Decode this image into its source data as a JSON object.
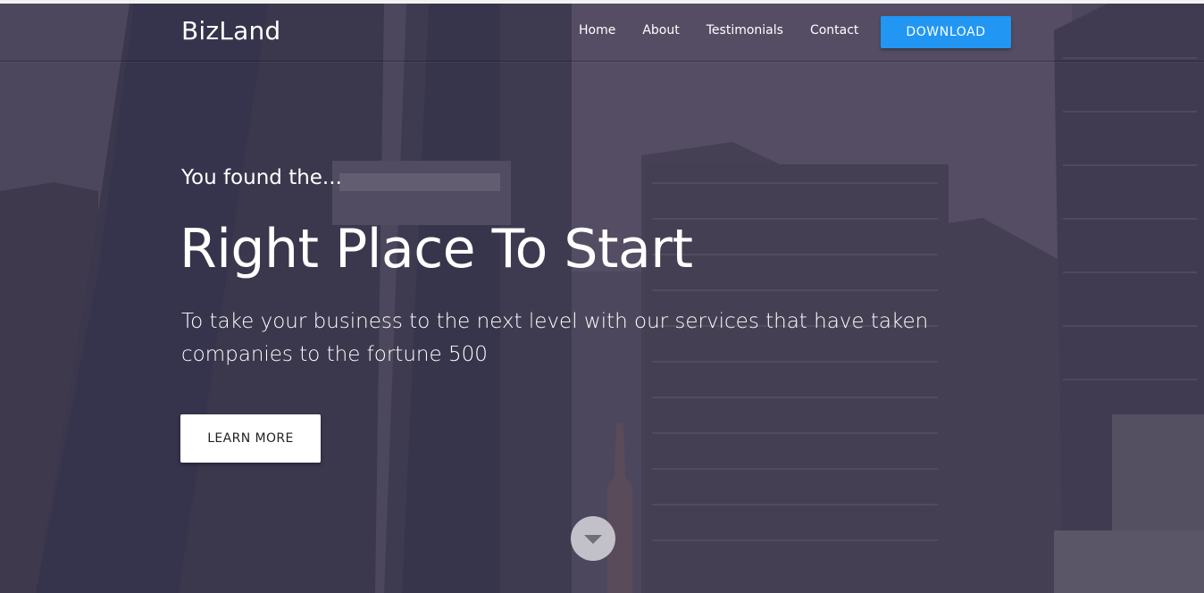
{
  "nav": {
    "brand": "BizLand",
    "links": [
      {
        "label": "Home"
      },
      {
        "label": "About"
      },
      {
        "label": "Testimonials"
      },
      {
        "label": "Contact"
      }
    ],
    "download_label": "DOWNLOAD"
  },
  "hero": {
    "pre_title": "You found the...",
    "title": "Right Place To Start",
    "subtitle": "To take your business to the next level with our services that have taken companies to the fortune 500",
    "cta_label": "LEARN MORE",
    "background_image": "city-skyscrapers-photo",
    "scroll_icon": "chevron-down-icon"
  },
  "colors": {
    "accent": "#2196f3",
    "overlay": "#4a4458",
    "text": "#ffffff"
  }
}
